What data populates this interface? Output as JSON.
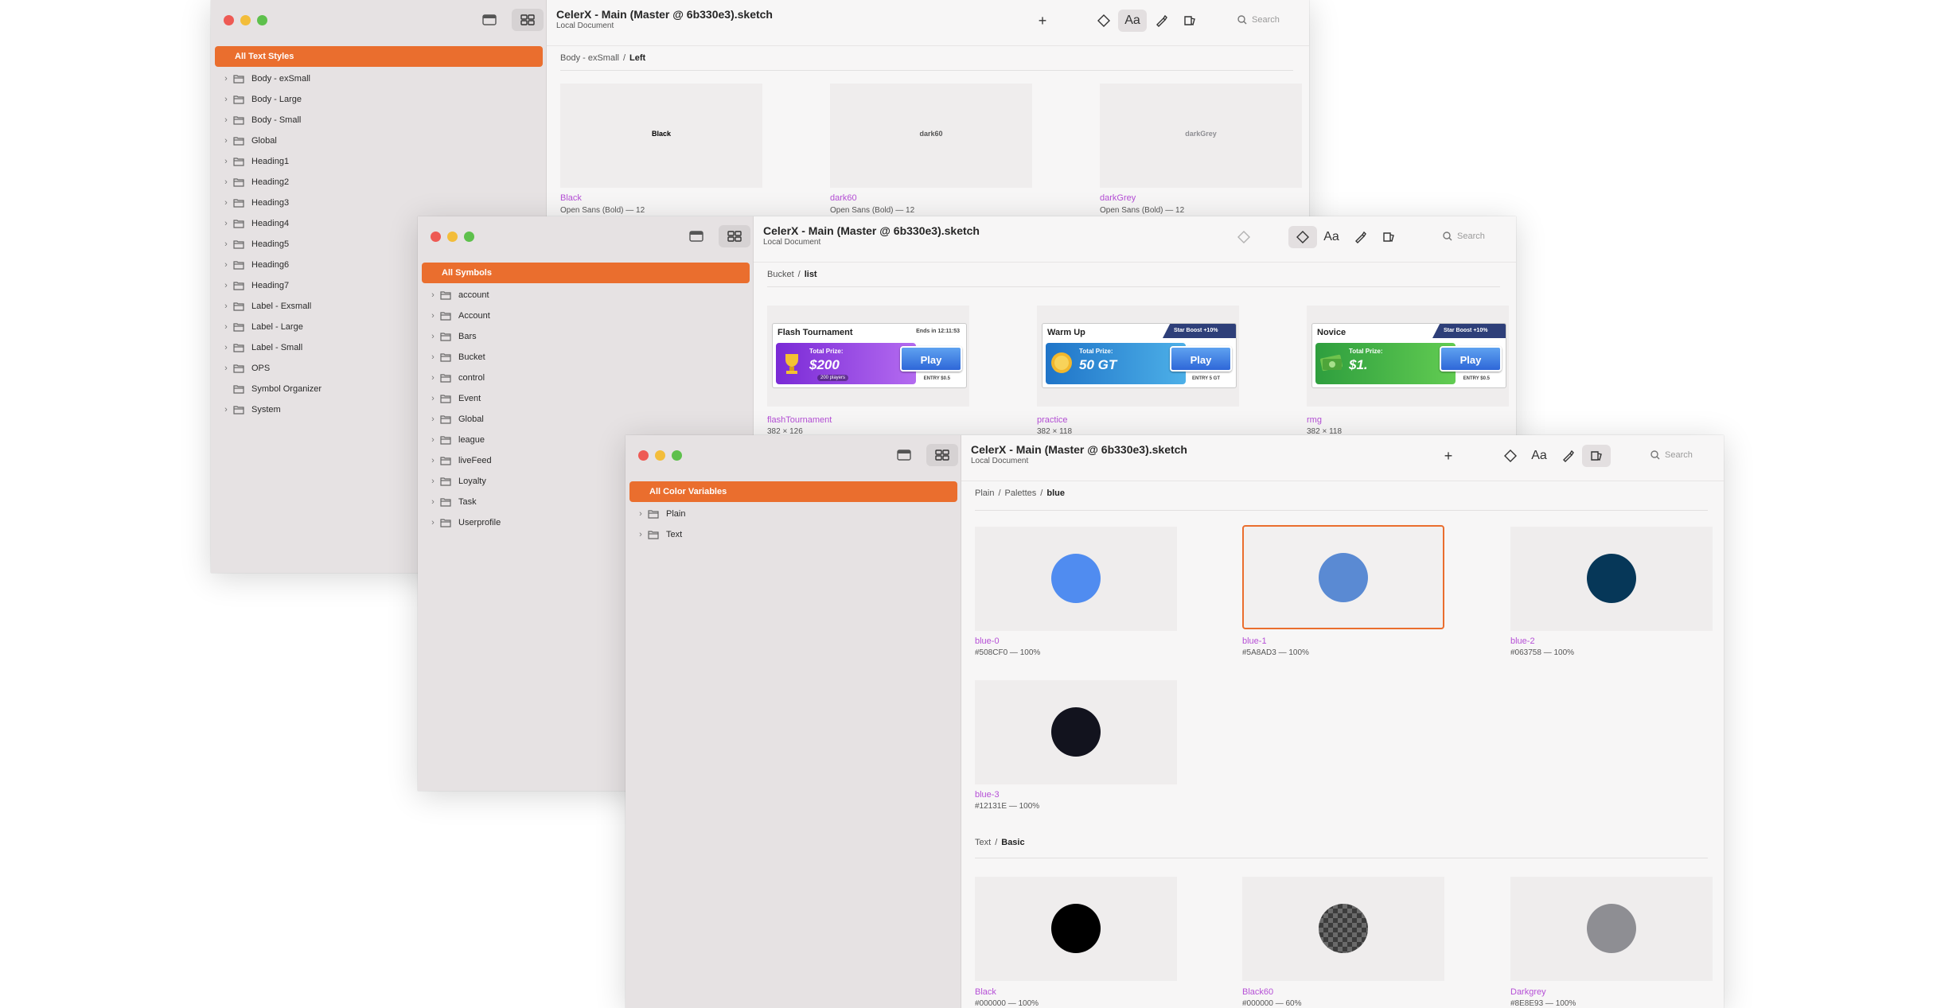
{
  "window_text_styles": {
    "all_label": "All Text Styles",
    "items": [
      "Body - exSmall",
      "Body - Large",
      "Body - Small",
      "Global",
      "Heading1",
      "Heading2",
      "Heading3",
      "Heading4",
      "Heading5",
      "Heading6",
      "Heading7",
      "Label - Exsmall",
      "Label - Large",
      "Label - Small",
      "OPS",
      "Symbol Organizer",
      "System"
    ],
    "title": "CelerX - Main (Master @ 6b330e3).sketch",
    "subtitle": "Local Document",
    "search_placeholder": "Search",
    "breadcrumb": {
      "parent": "Body - exSmall",
      "sep": "/",
      "current": "Left"
    },
    "tiles": [
      {
        "sample": "Black",
        "name": "Black",
        "meta": "Open Sans (Bold) — 12",
        "color": "#000000"
      },
      {
        "sample": "dark60",
        "name": "dark60",
        "meta": "Open Sans (Bold) — 12",
        "color": "#555555"
      },
      {
        "sample": "darkGrey",
        "name": "darkGrey",
        "meta": "Open Sans (Bold) — 12",
        "color": "#8E8E93"
      }
    ]
  },
  "window_symbols": {
    "all_label": "All Symbols",
    "items": [
      "account",
      "Account",
      "Bars",
      "Bucket",
      "control",
      "Event",
      "Global",
      "league",
      "liveFeed",
      "Loyalty",
      "Task",
      "Userprofile"
    ],
    "title": "CelerX - Main (Master @ 6b330e3).sketch",
    "subtitle": "Local Document",
    "search_placeholder": "Search",
    "breadcrumb": {
      "parent": "Bucket",
      "sep": "/",
      "current": "list"
    },
    "symbols": [
      {
        "card_title": "Flash Tournament",
        "ends": "Ends in 12:11:53",
        "prize_label": "Total Prize:",
        "amount": "$200",
        "players": "200 players",
        "play": "Play",
        "entry": "ENTRY $0.5",
        "name": "flashTournament",
        "size": "382 × 126"
      },
      {
        "card_title": "Warm Up",
        "boost": "Star Boost +10%",
        "prize_label": "Total Prize:",
        "amount": "50 GT",
        "play": "Play",
        "entry": "ENTRY 5 GT",
        "name": "practice",
        "size": "382 × 118"
      },
      {
        "card_title": "Novice",
        "boost": "Star Boost +10%",
        "prize_label": "Total Prize:",
        "amount": "$1.",
        "play": "Play",
        "entry": "ENTRY $0.5",
        "name": "rmg",
        "size": "382 × 118"
      }
    ]
  },
  "window_colors": {
    "all_label": "All Color Variables",
    "items": [
      "Plain",
      "Text"
    ],
    "title": "CelerX - Main (Master @ 6b330e3).sketch",
    "subtitle": "Local Document",
    "search_placeholder": "Search",
    "breadcrumb": {
      "p1": "Plain",
      "p2": "Palettes",
      "sep": "/",
      "current": "blue"
    },
    "section2": {
      "parent": "Text",
      "sep": "/",
      "current": "Basic"
    },
    "colors": [
      {
        "name": "blue-0",
        "meta": "#508CF0 — 100%",
        "hex": "#508CF0"
      },
      {
        "name": "blue-1",
        "meta": "#5A8AD3 — 100%",
        "hex": "#5A8AD3"
      },
      {
        "name": "blue-2",
        "meta": "#063758 — 100%",
        "hex": "#063758"
      },
      {
        "name": "blue-3",
        "meta": "#12131E — 100%",
        "hex": "#12131E"
      },
      {
        "name": "Black",
        "meta": "#000000 — 100%",
        "hex": "#000000"
      },
      {
        "name": "Black60",
        "meta": "#000000 — 60%",
        "hex": "#000000"
      },
      {
        "name": "Darkgrey",
        "meta": "#8E8E93 — 100%",
        "hex": "#8E8E93"
      }
    ]
  },
  "theme": {
    "accent": "#EA6E2E",
    "link": "#B54FD6"
  }
}
